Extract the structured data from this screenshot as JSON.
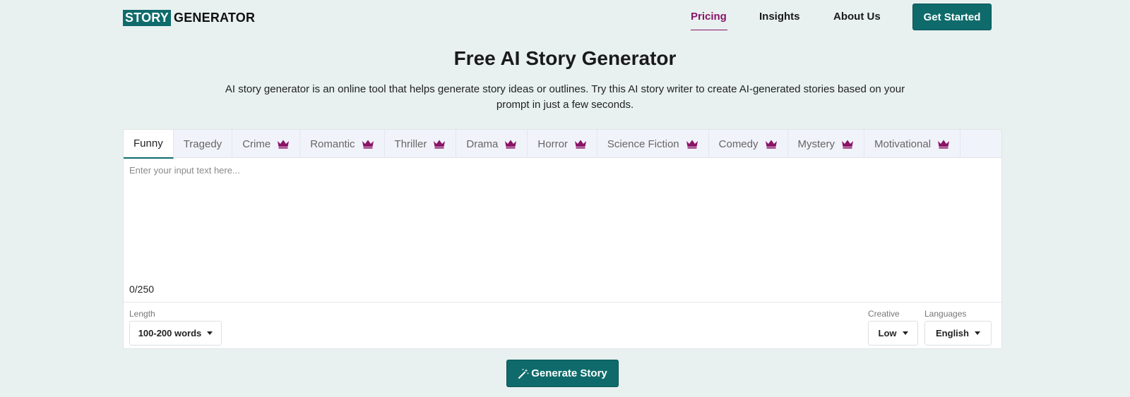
{
  "header": {
    "logo_box": "STORY",
    "logo_rest": "GENERATOR",
    "nav": {
      "pricing": "Pricing",
      "insights": "Insights",
      "about": "About Us"
    },
    "cta": "Get Started"
  },
  "hero": {
    "title": "Free AI Story Generator",
    "subtitle": "AI story generator is an online tool that helps generate story ideas or outlines. Try this AI story writer to create AI-generated stories based on your prompt in just a few seconds."
  },
  "tabs": [
    {
      "label": "Funny",
      "premium": false,
      "active": true
    },
    {
      "label": "Tragedy",
      "premium": false,
      "active": false
    },
    {
      "label": "Crime",
      "premium": true,
      "active": false
    },
    {
      "label": "Romantic",
      "premium": true,
      "active": false
    },
    {
      "label": "Thriller",
      "premium": true,
      "active": false
    },
    {
      "label": "Drama",
      "premium": true,
      "active": false
    },
    {
      "label": "Horror",
      "premium": true,
      "active": false
    },
    {
      "label": "Science Fiction",
      "premium": true,
      "active": false
    },
    {
      "label": "Comedy",
      "premium": true,
      "active": false
    },
    {
      "label": "Mystery",
      "premium": true,
      "active": false
    },
    {
      "label": "Motivational",
      "premium": true,
      "active": false
    }
  ],
  "input": {
    "placeholder": "Enter your input text here...",
    "value": "",
    "counter": "0/250"
  },
  "options": {
    "length_label": "Length",
    "length_value": "100-200 words",
    "creative_label": "Creative",
    "creative_value": "Low",
    "languages_label": "Languages",
    "languages_value": "English"
  },
  "generate_label": "Generate Story",
  "colors": {
    "brand": "#0f6b6b",
    "accent": "#8a1466",
    "crown": "#8a1466"
  }
}
